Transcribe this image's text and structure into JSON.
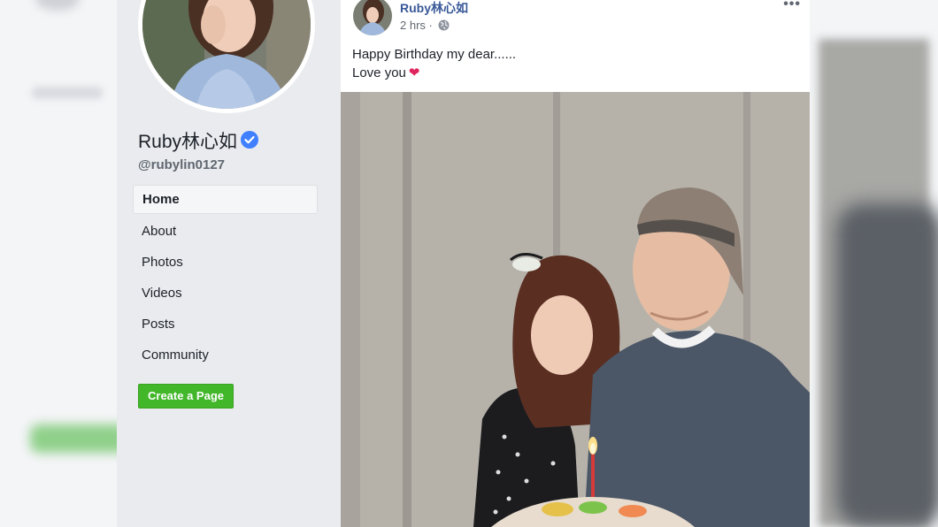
{
  "sidebar": {
    "page_name": "Ruby林心如",
    "handle": "@rubylin0127",
    "nav": [
      {
        "label": "Home",
        "active": true
      },
      {
        "label": "About"
      },
      {
        "label": "Photos"
      },
      {
        "label": "Videos"
      },
      {
        "label": "Posts"
      },
      {
        "label": "Community"
      }
    ],
    "create_page_label": "Create a Page"
  },
  "post": {
    "author": "Ruby林心如",
    "time": "2 hrs",
    "separator": "·",
    "privacy_icon": "globe-icon",
    "more_icon": "more-options-icon",
    "text_line1": "Happy Birthday my dear......",
    "text_line2": "Love you",
    "emoji": "❤"
  },
  "colors": {
    "sidebar_bg": "#e9ebee",
    "link_blue": "#385898",
    "verified_blue": "#4080ff",
    "create_page_green": "#42b72a",
    "heart_red": "#e0245e"
  }
}
